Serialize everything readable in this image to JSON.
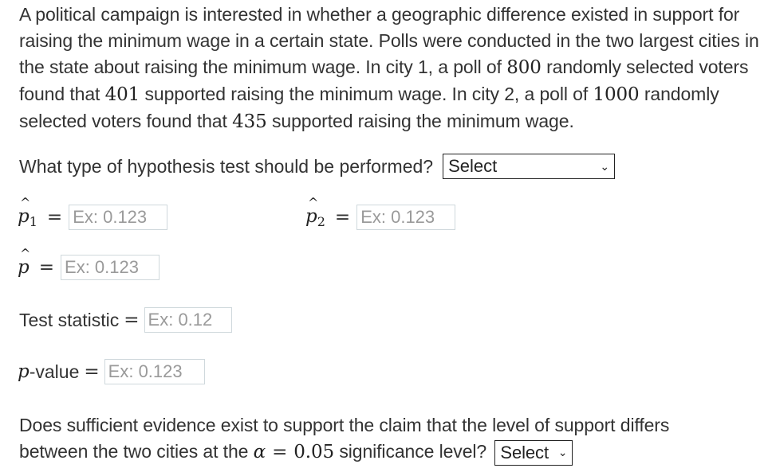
{
  "question": {
    "intro_1": "A political campaign is interested in whether a geographic difference existed in support for raising the minimum wage in a certain state. Polls were conducted in the two largest cities in the state about raising the minimum wage. In city 1, a poll of ",
    "n1": "800",
    "intro_2": " randomly selected voters found that ",
    "x1": "401",
    "intro_3": " supported raising the minimum wage. In city 2, a poll of ",
    "n2": "1000",
    "intro_4": " randomly selected voters found that ",
    "x2": "435",
    "intro_5": " supported raising the minimum wage."
  },
  "test_type": {
    "label": "What type of hypothesis test should be performed?",
    "selected": "Select"
  },
  "p1": {
    "symbol": "p",
    "sub": "1",
    "eq": "=",
    "placeholder": "Ex: 0.123"
  },
  "p2": {
    "symbol": "p",
    "sub": "2",
    "eq": "=",
    "placeholder": "Ex: 0.123"
  },
  "p_pooled": {
    "symbol": "p",
    "eq": "=",
    "placeholder": "Ex: 0.123"
  },
  "test_statistic": {
    "label": "Test statistic",
    "eq": "=",
    "placeholder": "Ex: 0.12"
  },
  "p_value": {
    "symbol": "p",
    "label": "-value",
    "eq": "=",
    "placeholder": "Ex: 0.123"
  },
  "conclusion": {
    "text_1": "Does sufficient evidence exist to support the claim that the level of support differs between the two cities at the ",
    "alpha": "α",
    "eq": "=",
    "alpha_value": "0.05",
    "text_2": " significance level?",
    "selected": "Select"
  },
  "icons": {
    "chevron": "⌄"
  }
}
